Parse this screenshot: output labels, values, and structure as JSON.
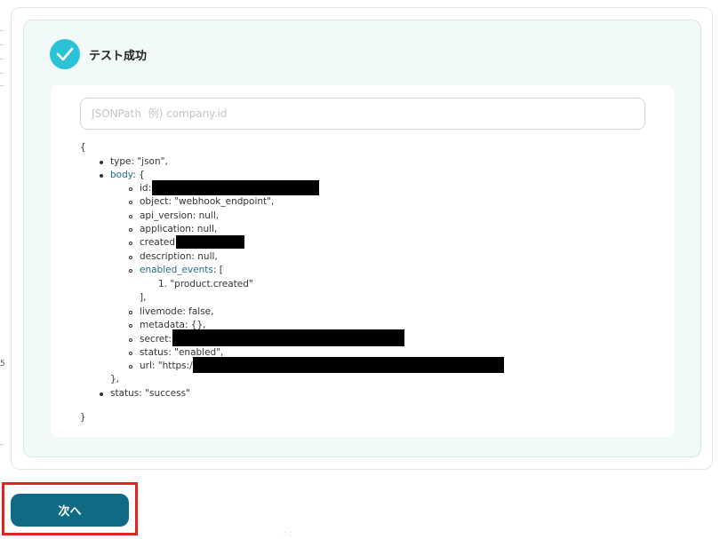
{
  "header": {
    "title": "テスト成功"
  },
  "search": {
    "placeholder": "JSONPath  例) company.id",
    "value": ""
  },
  "json": {
    "open_brace": "{",
    "type_line": "type: \"json\",",
    "body_key": "body",
    "body_open": ": {",
    "id_label": "id:",
    "object_line": "object: \"webhook_endpoint\",",
    "api_version_line": "api_version: null,",
    "application_line": "application: null,",
    "created_label": "created:",
    "description_line": "description: null,",
    "enabled_events_key": "enabled_events",
    "enabled_events_open": ": [",
    "event_item": "1. \"product.created\"",
    "array_close": "],",
    "livemode_line": "livemode: false,",
    "metadata_line": "metadata: {},",
    "secret_label": "secret:",
    "status_inner_line": "status: \"enabled\",",
    "url_label": "url: \"https:/",
    "body_close": "},",
    "status_line": "status: \"success\"",
    "close_brace": "}"
  },
  "footer": {
    "next_label": "次へ"
  },
  "edge": {
    "char": "5"
  },
  "colors": {
    "accent": "#0f6a84",
    "check": "#2cc2d6",
    "highlight": "#e02323",
    "panel_bg": "#f1f9f9"
  }
}
